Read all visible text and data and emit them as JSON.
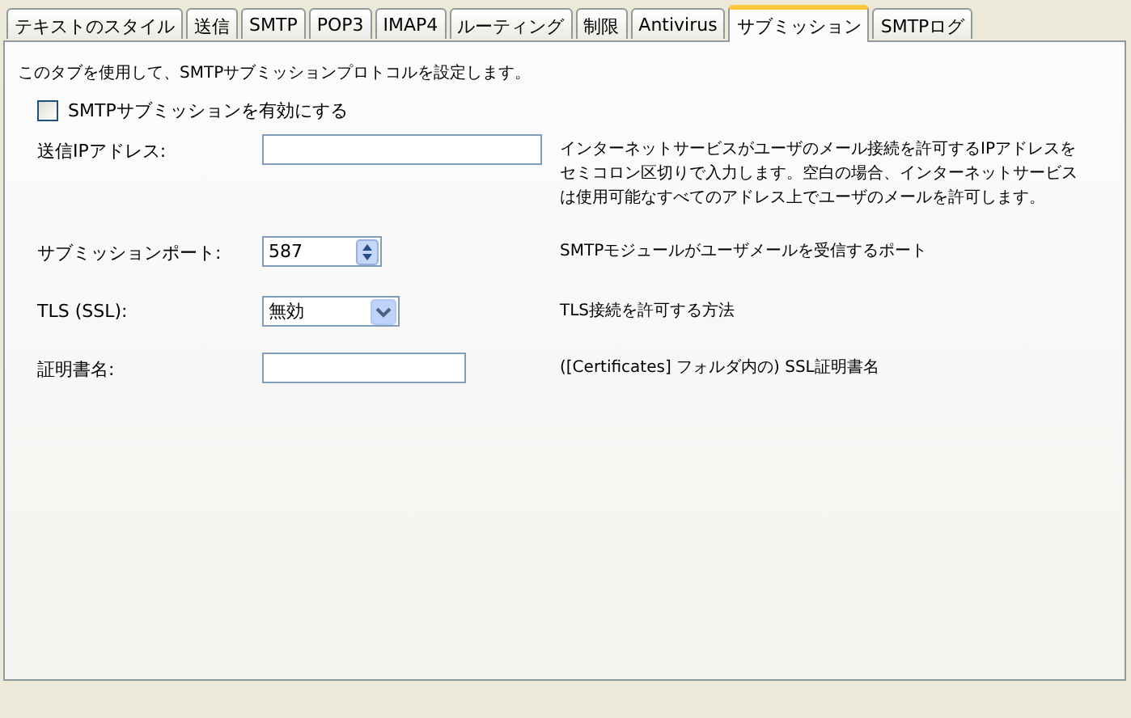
{
  "tabs": [
    {
      "label": "テキストのスタイル",
      "selected": false
    },
    {
      "label": "送信",
      "selected": false
    },
    {
      "label": "SMTP",
      "selected": false
    },
    {
      "label": "POP3",
      "selected": false
    },
    {
      "label": "IMAP4",
      "selected": false
    },
    {
      "label": "ルーティング",
      "selected": false
    },
    {
      "label": "制限",
      "selected": false
    },
    {
      "label": "Antivirus",
      "selected": false
    },
    {
      "label": "サブミッション",
      "selected": true
    },
    {
      "label": "SMTPログ",
      "selected": false
    }
  ],
  "intro": "このタブを使用して、SMTPサブミッションプロトコルを設定します。",
  "enable": {
    "label": "SMTPサブミッションを有効にする",
    "checked": false
  },
  "fields": [
    {
      "kind": "text",
      "label": "送信IPアドレス:",
      "description": "インターネットサービスがユーザのメール接続を許可するIPアドレスをセミコロン区切りで入力します。空白の場合、インターネットサービスは使用可能なすべてのアドレス上でユーザのメールを許可します。"
    },
    {
      "kind": "spinner",
      "label": "サブミッションポート:",
      "value": "587",
      "description": "SMTPモジュールがユーザメールを受信するポート"
    },
    {
      "kind": "select",
      "label": "TLS (SSL):",
      "value": "無効",
      "description": "TLS接続を許可する方法"
    },
    {
      "kind": "short-text",
      "label": "証明書名:",
      "description": "([Certificates] フォルダ内の) SSL証明書名"
    }
  ]
}
